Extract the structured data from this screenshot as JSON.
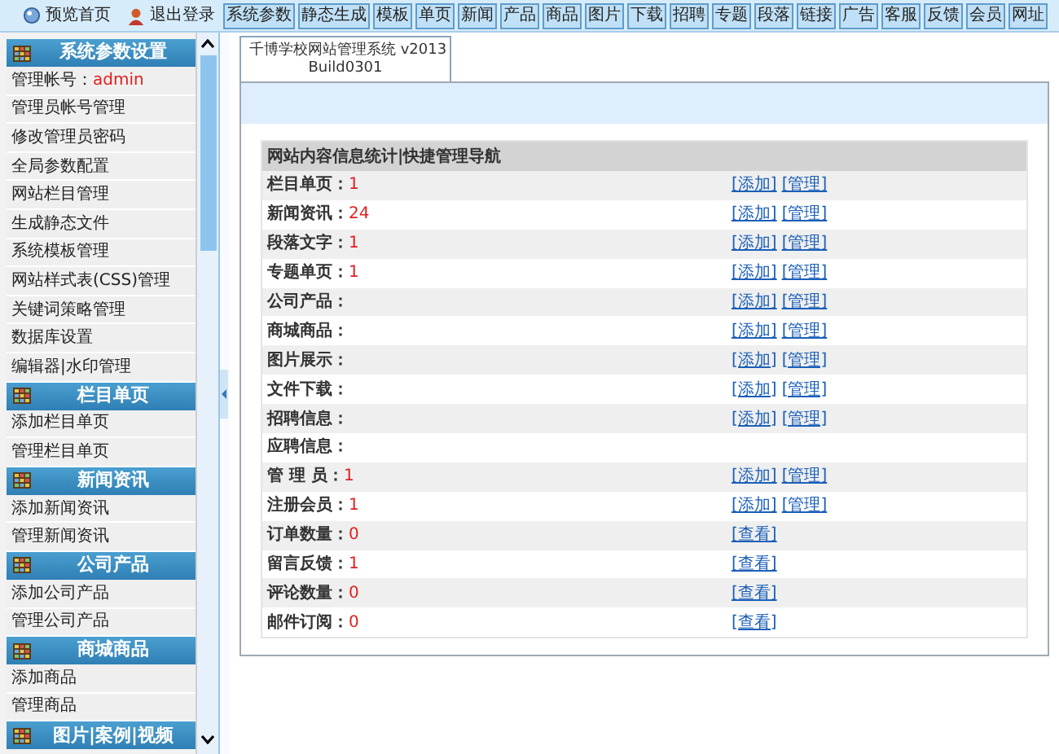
{
  "top_bar": {
    "links": [
      {
        "label": "预览首页",
        "kind": "home"
      },
      {
        "label": "退出登录",
        "kind": "logout"
      }
    ],
    "nav": [
      "系统参数",
      "静态生成",
      "模板",
      "单页",
      "新闻",
      "产品",
      "商品",
      "图片",
      "下载",
      "招聘",
      "专题",
      "段落",
      "链接",
      "广告",
      "客服",
      "反馈",
      "会员",
      "网址"
    ]
  },
  "sidebar": {
    "sections": [
      {
        "title": "系统参数设置",
        "items": [
          {
            "label": "管理帐号：",
            "value": "admin"
          },
          {
            "label": "管理员帐号管理"
          },
          {
            "label": "修改管理员密码"
          },
          {
            "label": "全局参数配置"
          },
          {
            "label": "网站栏目管理"
          },
          {
            "label": "生成静态文件"
          },
          {
            "label": "系统模板管理"
          },
          {
            "label": "网站样式表(CSS)管理"
          },
          {
            "label": "关键词策略管理"
          },
          {
            "label": "数据库设置"
          },
          {
            "label": "编辑器|水印管理"
          }
        ]
      },
      {
        "title": "栏目单页",
        "items": [
          {
            "label": "添加栏目单页"
          },
          {
            "label": "管理栏目单页"
          }
        ]
      },
      {
        "title": "新闻资讯",
        "items": [
          {
            "label": "添加新闻资讯"
          },
          {
            "label": "管理新闻资讯"
          }
        ]
      },
      {
        "title": "公司产品",
        "items": [
          {
            "label": "添加公司产品"
          },
          {
            "label": "管理公司产品"
          }
        ]
      },
      {
        "title": "商城商品",
        "items": [
          {
            "label": "添加商品"
          },
          {
            "label": "管理商品"
          }
        ]
      },
      {
        "title": "图片|案例|视频"
      }
    ]
  },
  "main": {
    "tab": {
      "title": "千博学校网站管理系统 v2013",
      "subtitle": "Build0301"
    },
    "table": {
      "heading": "网站内容信息统计|快捷管理导航",
      "rows": [
        {
          "label": "栏目单页：",
          "value": "1",
          "links": [
            "[添加]",
            "[管理]"
          ]
        },
        {
          "label": "新闻资讯：",
          "value": "24",
          "links": [
            "[添加]",
            "[管理]"
          ]
        },
        {
          "label": "段落文字：",
          "value": "1",
          "links": [
            "[添加]",
            "[管理]"
          ]
        },
        {
          "label": "专题单页：",
          "value": "1",
          "links": [
            "[添加]",
            "[管理]"
          ]
        },
        {
          "label": "公司产品：",
          "links": [
            "[添加]",
            "[管理]"
          ]
        },
        {
          "label": "商城商品：",
          "links": [
            "[添加]",
            "[管理]"
          ]
        },
        {
          "label": "图片展示：",
          "links": [
            "[添加]",
            "[管理]"
          ]
        },
        {
          "label": "文件下载：",
          "links": [
            "[添加]",
            "[管理]"
          ]
        },
        {
          "label": "招聘信息：",
          "links": [
            "[添加]",
            "[管理]"
          ]
        },
        {
          "label": "应聘信息："
        },
        {
          "label": "管 理 员：",
          "value": "1",
          "links": [
            "[添加]",
            "[管理]"
          ]
        },
        {
          "label": "注册会员：",
          "value": "1",
          "links": [
            "[添加]",
            "[管理]"
          ]
        },
        {
          "label": "订单数量：",
          "value": "0",
          "links": [
            "[查看]"
          ]
        },
        {
          "label": "留言反馈：",
          "value": "1",
          "links": [
            "[查看]"
          ]
        },
        {
          "label": "评论数量：",
          "value": "0",
          "links": [
            "[查看]"
          ]
        },
        {
          "label": "邮件订阅：",
          "value": "0",
          "links": [
            "[查看]"
          ]
        }
      ]
    }
  }
}
